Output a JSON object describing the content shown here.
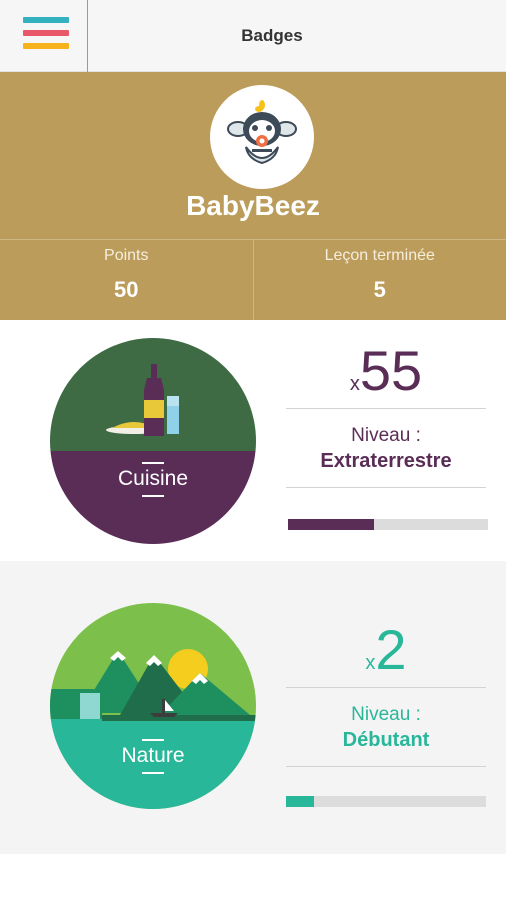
{
  "header": {
    "title": "Badges",
    "menu_icon": "hamburger-menu-icon"
  },
  "profile": {
    "avatar_icon": "bee-mascot-avatar-icon",
    "username": "BabyBeez",
    "stats": [
      {
        "label": "Points",
        "value": "50"
      },
      {
        "label": "Leçon terminée",
        "value": "5"
      }
    ]
  },
  "badges": [
    {
      "name": "Cuisine",
      "multiplier": "x",
      "count": "55",
      "level_label": "Niveau :",
      "level_value": "Extraterrestre",
      "progress": 0.43,
      "icon": "wine-bottle-glass-plate-icon",
      "colors": {
        "accent": "#5a2d57",
        "top": "#3e6b44"
      }
    },
    {
      "name": "Nature",
      "multiplier": "x",
      "count": "2",
      "level_label": "Niveau :",
      "level_value": "Débutant",
      "progress": 0.14,
      "icon": "mountains-sun-boat-icon",
      "colors": {
        "accent": "#29b79a",
        "top": "#7cc04b"
      }
    }
  ],
  "colors": {
    "profile_bg": "#bc9c5b",
    "menu_bar_1": "#33b1be",
    "menu_bar_2": "#e8586a",
    "menu_bar_3": "#f6b31d"
  }
}
